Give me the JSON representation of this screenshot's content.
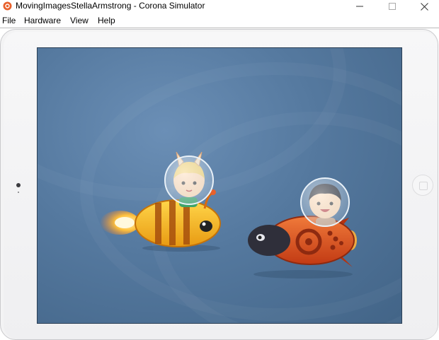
{
  "window": {
    "title": "MovingImagesStellaArmstrong - Corona Simulator",
    "app_icon": "corona-icon",
    "controls": {
      "minimize": "minimize-icon",
      "maximize": "maximize-icon",
      "close": "close-icon"
    }
  },
  "menu": {
    "items": [
      {
        "label": "File"
      },
      {
        "label": "Hardware"
      },
      {
        "label": "View"
      },
      {
        "label": "Help"
      }
    ]
  },
  "device": {
    "type": "tablet-landscape",
    "screen": {
      "background_color": "#55799f",
      "sprites": [
        {
          "name": "bee-rocket-sprite",
          "description": "girl astronaut riding yellow-striped bee rocket"
        },
        {
          "name": "ladybug-rocket-sprite",
          "description": "boy astronaut riding red ladybug rocket"
        }
      ]
    }
  },
  "colors": {
    "bezel": "#f3f3f4",
    "screen_bg": "#55799f",
    "accent_orange": "#e8612c"
  }
}
